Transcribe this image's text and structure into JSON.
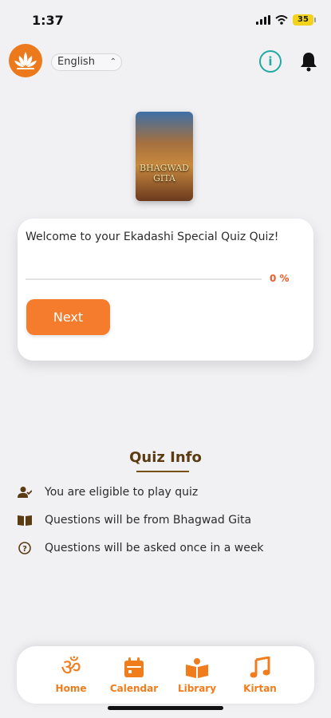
{
  "status_bar": {
    "time": "1:37",
    "battery": "35"
  },
  "header": {
    "language": "English",
    "icons": [
      "lotus-logo-icon",
      "info-icon",
      "bell-icon"
    ]
  },
  "book": {
    "title_line1": "BHAGWAD",
    "title_line2": "GITA"
  },
  "quiz_card": {
    "welcome": "Welcome to your Ekadashi Special Quiz Quiz!",
    "progress_percent": 0,
    "progress_label": "0 %",
    "next_label": "Next"
  },
  "quiz_info": {
    "title": "Quiz Info",
    "items": [
      {
        "icon": "user-check-icon",
        "text": "You are eligible to play quiz"
      },
      {
        "icon": "open-book-icon",
        "text": "Questions will be from Bhagwad Gita"
      },
      {
        "icon": "question-circle-icon",
        "text": "Questions will be asked once in a week"
      }
    ]
  },
  "bottom_nav": {
    "items": [
      {
        "label": "Home",
        "icon": "om-icon"
      },
      {
        "label": "Calendar",
        "icon": "calendar-icon"
      },
      {
        "label": "Library",
        "icon": "library-book-icon"
      },
      {
        "label": "Kirtan",
        "icon": "music-note-icon"
      }
    ]
  },
  "colors": {
    "accent": "#f47c2c",
    "info_teal": "#22a9a3",
    "heading_brown": "#5a3b12"
  }
}
